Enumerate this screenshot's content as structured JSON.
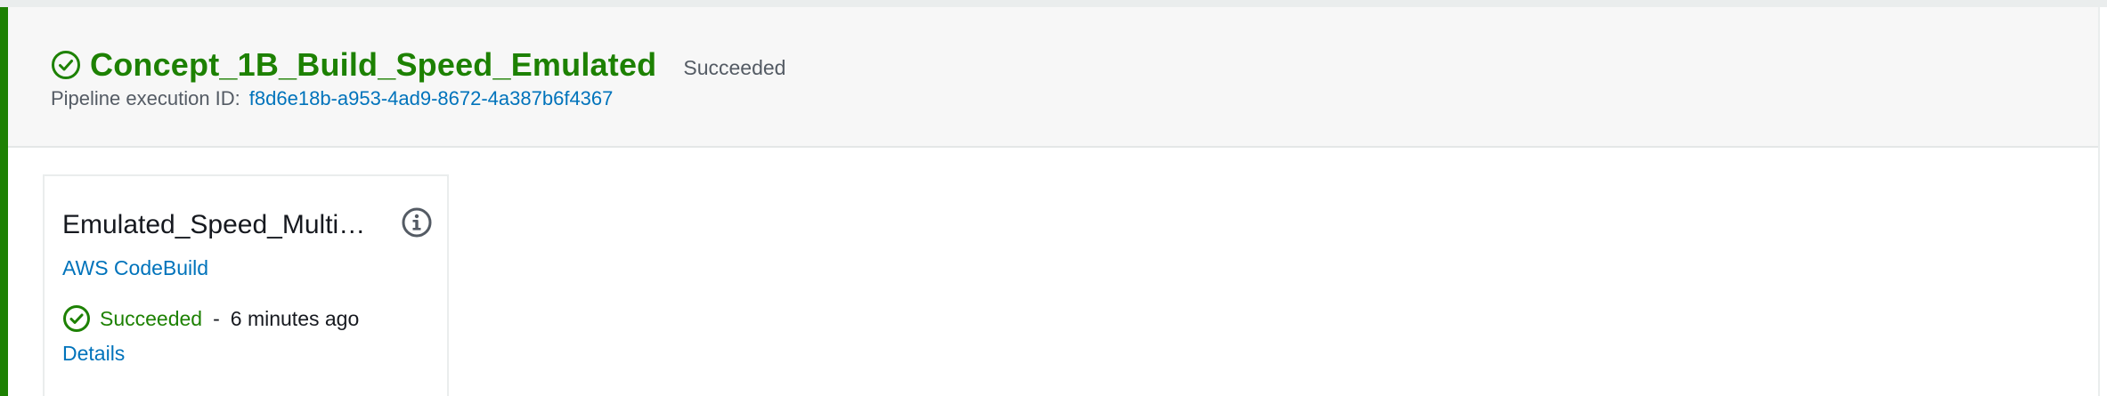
{
  "stage": {
    "name": "Concept_1B_Build_Speed_Emulated",
    "status": "Succeeded",
    "execution_label": "Pipeline execution ID:",
    "execution_id": "f8d6e18b-a953-4ad9-8672-4a387b6f4367"
  },
  "action": {
    "name": "Emulated_Speed_Multi…",
    "provider": "AWS CodeBuild",
    "status": "Succeeded",
    "separator": "-",
    "time_ago": "6 minutes ago",
    "details_label": "Details"
  },
  "icons": {
    "status": "check-circle-icon",
    "info": "info-icon"
  },
  "colors": {
    "success": "#1d8102",
    "link": "#0073bb",
    "text": "#16191f",
    "muted": "#545b64"
  }
}
